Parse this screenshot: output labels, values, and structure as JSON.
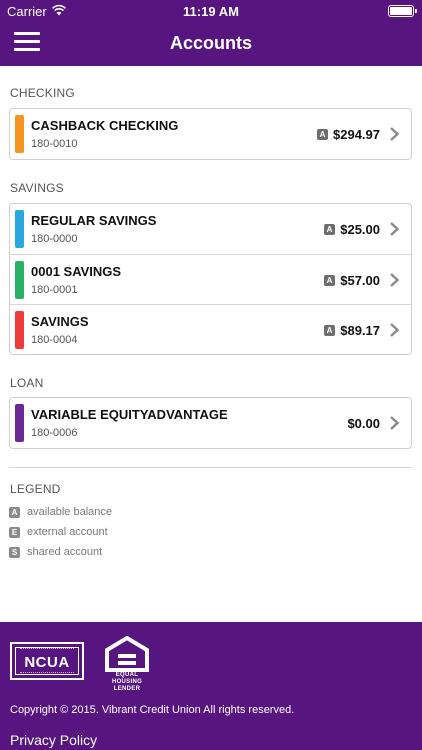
{
  "status_bar": {
    "carrier": "Carrier",
    "time": "11:19 AM",
    "wifi_icon": "wifi-icon",
    "battery_icon": "battery-icon"
  },
  "header": {
    "title": "Accounts",
    "menu_icon": "hamburger-menu-icon"
  },
  "sections": {
    "checking": {
      "label": "CHECKING",
      "accounts": [
        {
          "name": "CASHBACK CHECKING",
          "number": "180-0010",
          "badge": "A",
          "amount": "$294.97",
          "color": "#f5931f"
        }
      ]
    },
    "savings": {
      "label": "SAVINGS",
      "accounts": [
        {
          "name": "REGULAR SAVINGS",
          "number": "180-0000",
          "badge": "A",
          "amount": "$25.00",
          "color": "#29a8e0"
        },
        {
          "name": "0001 SAVINGS",
          "number": "180-0001",
          "badge": "A",
          "amount": "$57.00",
          "color": "#2ab163"
        },
        {
          "name": "SAVINGS",
          "number": "180-0004",
          "badge": "A",
          "amount": "$89.17",
          "color": "#ee3b3b"
        }
      ]
    },
    "loan": {
      "label": "LOAN",
      "accounts": [
        {
          "name": "VARIABLE EQUITYADVANTAGE",
          "number": "180-0006",
          "amount": "$0.00",
          "color": "#6b2a93"
        }
      ]
    }
  },
  "legend": {
    "label": "LEGEND",
    "items": [
      {
        "badge": "A",
        "text": "available balance"
      },
      {
        "badge": "E",
        "text": "external account"
      },
      {
        "badge": "S",
        "text": "shared account"
      }
    ]
  },
  "footer": {
    "ncua_logo_text": "NCUA",
    "ehl_logo_text": "EQUAL HOUSING LENDER",
    "copyright": "Copyright © 2015. Vibrant Credit Union All rights reserved.",
    "privacy_link": "Privacy Policy"
  },
  "colors": {
    "brand": "#56157f"
  }
}
